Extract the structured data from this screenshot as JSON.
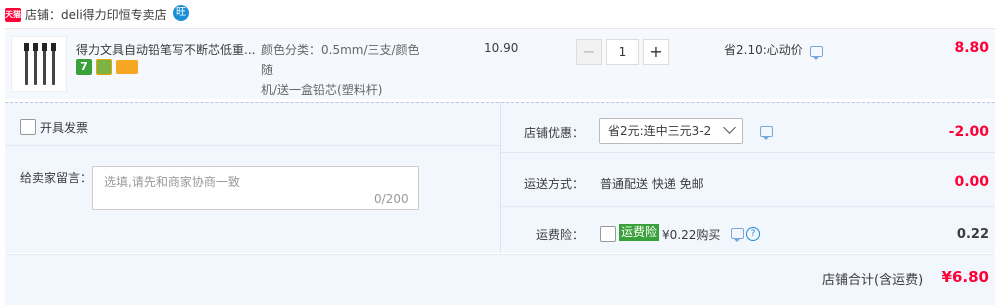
{
  "shop": {
    "badge": "天猫",
    "label": "店铺：deli得力印恒专卖店",
    "ww": "旺"
  },
  "item": {
    "title": "得力文具自动铅笔写不断芯低重...",
    "badge_seven": "7",
    "sku_line1": "颜色分类：0.5mm/三支/颜色随",
    "sku_line2": "机/送一盒铅芯(塑料杆)",
    "price": "10.90",
    "qty_minus": "−",
    "qty": "1",
    "qty_plus": "+",
    "promo": "省2.10:心动价",
    "subtotal": "8.80"
  },
  "invoice": {
    "label": "开具发票"
  },
  "message": {
    "label": "给卖家留言：",
    "placeholder": "选填,请先和商家协商一致",
    "count": "0/200"
  },
  "shop_coupon": {
    "label": "店铺优惠：",
    "selected": "省2元:连中三元3-2",
    "amount": "-2.00"
  },
  "shipping": {
    "label": "运送方式：",
    "value": "普通配送 快递 免邮",
    "amount": "0.00"
  },
  "insurance": {
    "label": "运费险：",
    "badge": "运费险",
    "text": "¥0.22购买",
    "help": "?",
    "amount": "0.22"
  },
  "footer": {
    "total_label": "店铺合计(含运费)",
    "total": "¥6.80"
  }
}
